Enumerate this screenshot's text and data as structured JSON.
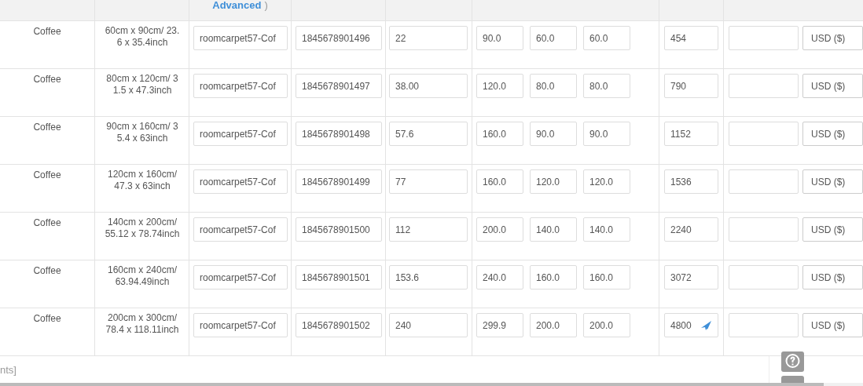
{
  "header": {
    "link": "Advanced",
    "paren": ")"
  },
  "rows": [
    {
      "variant": "Coffee",
      "size": "60cm x 90cm/ 23.6 x 35.4inch",
      "sku": "roomcarpet57-Cof",
      "barcode": "1845678901496",
      "price": "22",
      "dims": [
        "90.0",
        "60.0",
        "60.0"
      ],
      "value": "454",
      "send_icon": false,
      "currency": "USD ($)"
    },
    {
      "variant": "Coffee",
      "size": "80cm x 120cm/ 31.5 x 47.3inch",
      "sku": "roomcarpet57-Cof",
      "barcode": "1845678901497",
      "price": "38.00",
      "dims": [
        "120.0",
        "80.0",
        "80.0"
      ],
      "value": "790",
      "send_icon": false,
      "currency": "USD ($)"
    },
    {
      "variant": "Coffee",
      "size": "90cm x 160cm/ 35.4 x 63inch",
      "sku": "roomcarpet57-Cof",
      "barcode": "1845678901498",
      "price": "57.6",
      "dims": [
        "160.0",
        "90.0",
        "90.0"
      ],
      "value": "1152",
      "send_icon": false,
      "currency": "USD ($)"
    },
    {
      "variant": "Coffee",
      "size": "120cm x 160cm/ 47.3 x 63inch",
      "sku": "roomcarpet57-Cof",
      "barcode": "1845678901499",
      "price": "77",
      "dims": [
        "160.0",
        "120.0",
        "120.0"
      ],
      "value": "1536",
      "send_icon": false,
      "currency": "USD ($)"
    },
    {
      "variant": "Coffee",
      "size": "140cm x 200cm/ 55.12 x 78.74inch",
      "sku": "roomcarpet57-Cof",
      "barcode": "1845678901500",
      "price": "112",
      "dims": [
        "200.0",
        "140.0",
        "140.0"
      ],
      "value": "2240",
      "send_icon": false,
      "currency": "USD ($)"
    },
    {
      "variant": "Coffee",
      "size": "160cm x 240cm/ 63.94.49inch",
      "sku": "roomcarpet57-Cof",
      "barcode": "1845678901501",
      "price": "153.6",
      "dims": [
        "240.0",
        "160.0",
        "160.0"
      ],
      "value": "3072",
      "send_icon": false,
      "currency": "USD ($)"
    },
    {
      "variant": "Coffee",
      "size": "200cm x 300cm/ 78.4 x 118.11inch",
      "sku": "roomcarpet57-Cof",
      "barcode": "1845678901502",
      "price": "240",
      "dims": [
        "299.9",
        "200.0",
        "200.0"
      ],
      "value": "4800",
      "send_icon": true,
      "currency": "USD ($)"
    }
  ],
  "footer": {
    "text": "nts]"
  }
}
